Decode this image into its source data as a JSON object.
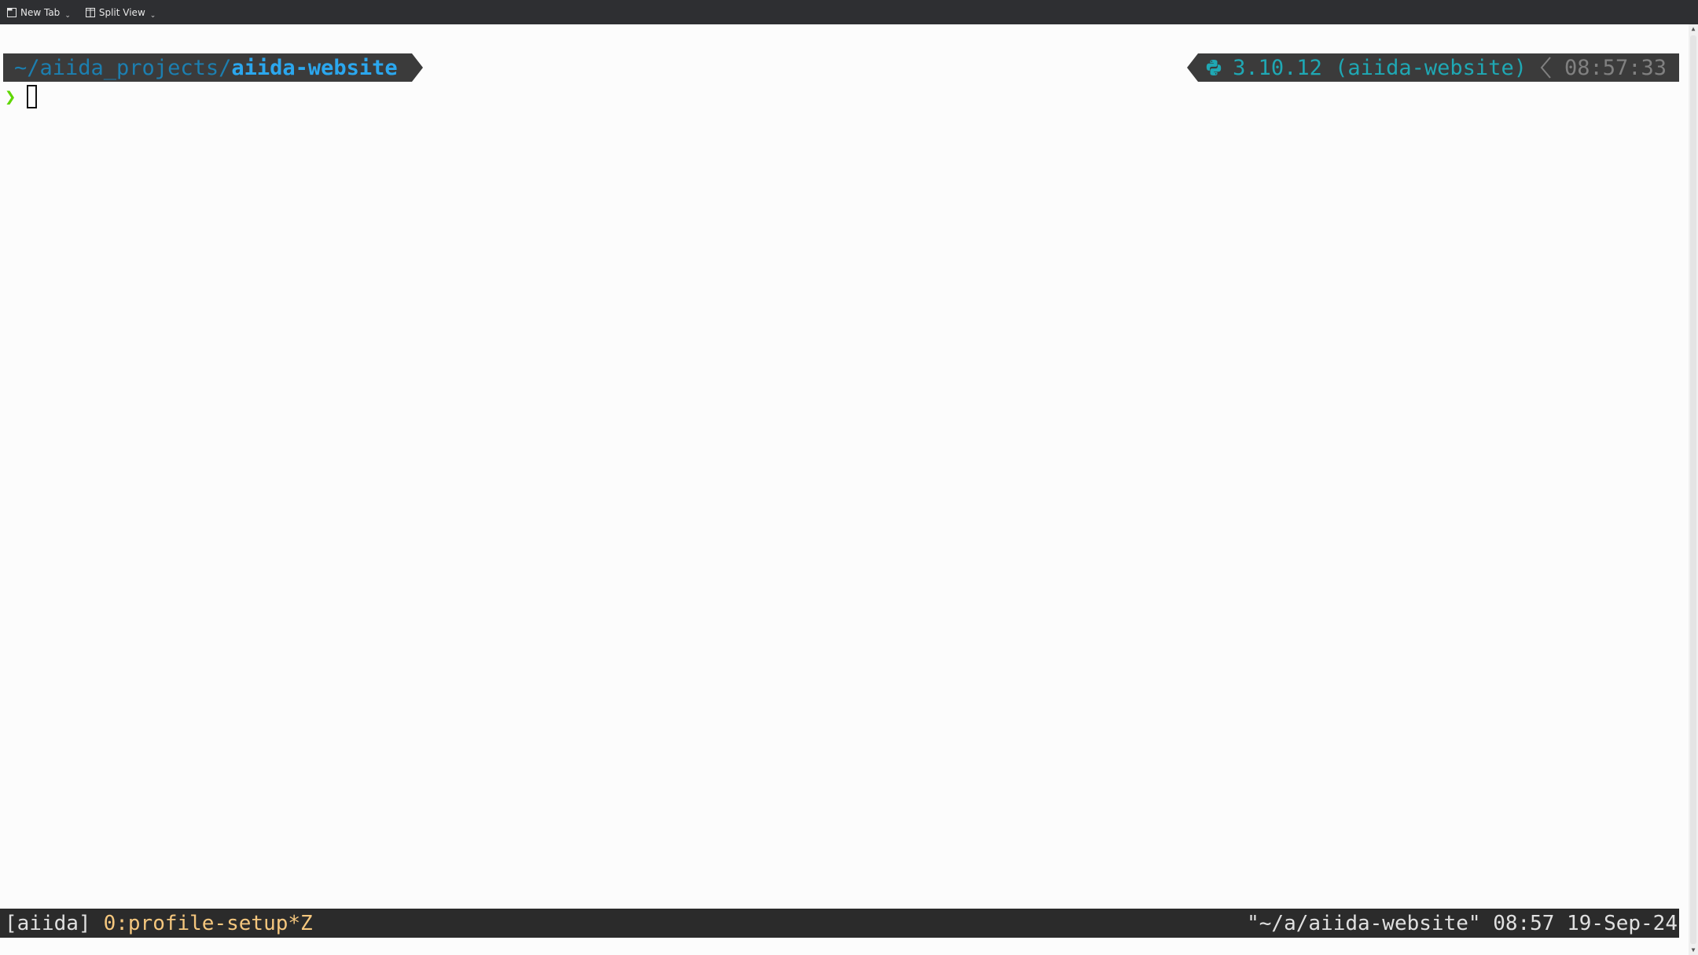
{
  "toolbar": {
    "new_tab_label": "New Tab",
    "split_view_label": "Split View"
  },
  "prompt": {
    "path_prefix": "~/aiida_projects/",
    "path_current": "aiida-website",
    "python_env": "3.10.12 (aiida-website)",
    "time": "08:57:33",
    "prompt_symbol": "❯"
  },
  "tmux": {
    "session": "[aiida]",
    "window": "0:profile-setup*Z",
    "right": "\"~/a/aiida-website\" 08:57 19-Sep-24"
  },
  "colors": {
    "segment_bg": "#3b3b3b",
    "path_dim": "#1c7fb0",
    "path_bold": "#2ba7ee",
    "python": "#1fa8b4",
    "time": "#808080",
    "prompt_symbol": "#5fd700",
    "status_bg": "#2b2b2b",
    "window_name": "#f5c77e"
  },
  "icons": {
    "new_tab": "new-tab-icon",
    "split_view": "split-view-icon",
    "python": "python-icon",
    "separator": "chevron-left-separator-icon"
  }
}
